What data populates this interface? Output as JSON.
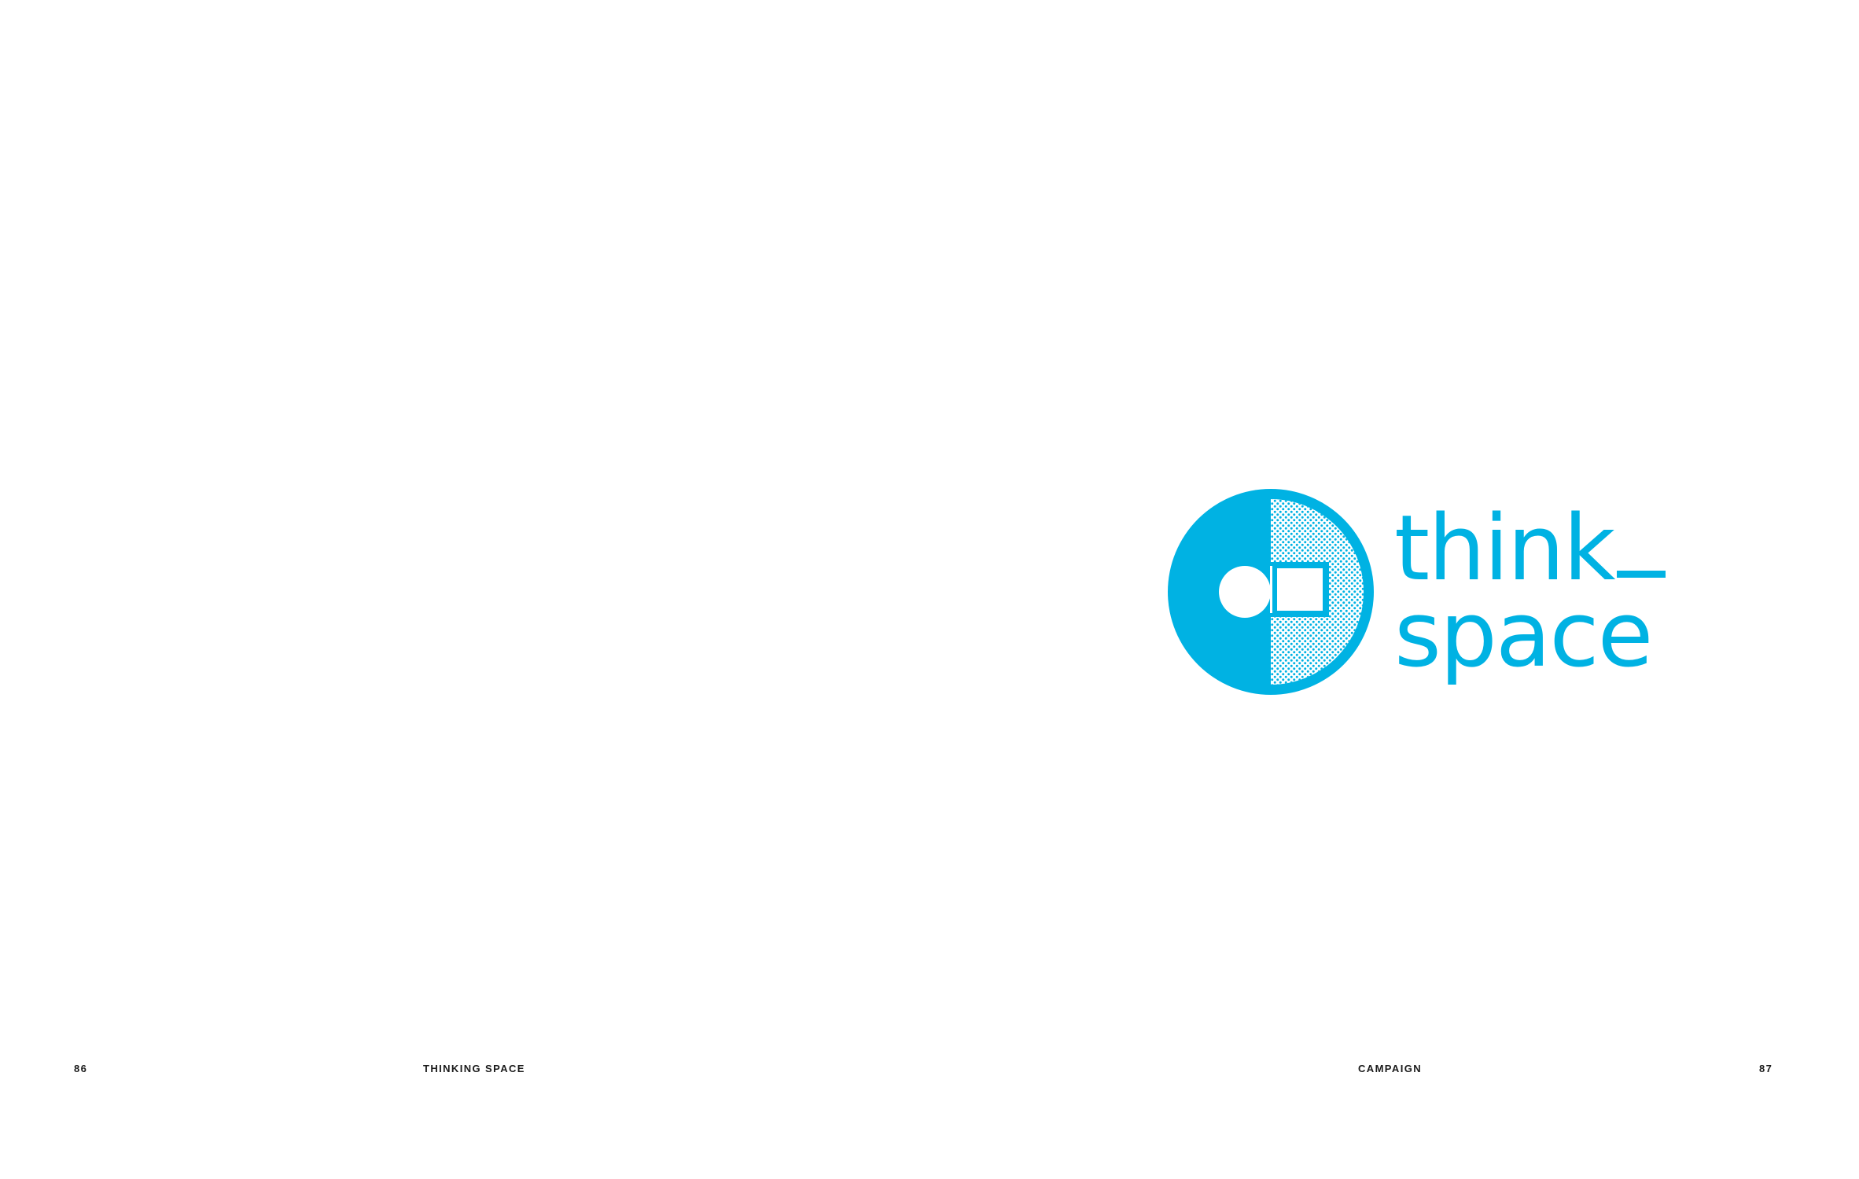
{
  "colors": {
    "brand": "#00b2e3",
    "background": "#ffffff",
    "folio_text": "#1a1a1a"
  },
  "logo": {
    "mark_icon": "think-space-circle-mark",
    "wordmark_line1": "think",
    "wordmark_line2": "space"
  },
  "folios": {
    "left_page_number": "86",
    "left_section_title": "THINKING SPACE",
    "right_section_title": "CAMPAIGN",
    "right_page_number": "87"
  }
}
